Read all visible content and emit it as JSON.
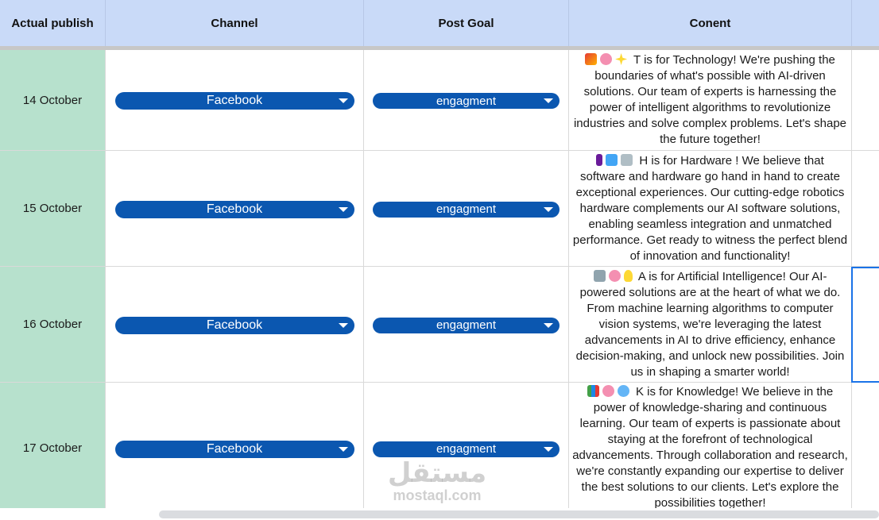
{
  "headers": {
    "actual_publish": "Actual publish",
    "channel": "Channel",
    "post_goal": "Post Goal",
    "content": "Conent"
  },
  "rows": [
    {
      "date": "14 October",
      "channel": "Facebook",
      "goal": "engagment",
      "emojis": [
        "rocket",
        "brain",
        "sparkles"
      ],
      "content": "T is for Technology! We're pushing the boundaries of what's possible with AI-driven solutions. Our team of experts is harnessing the power of intelligent algorithms to revolutionize industries and solve complex problems. Let's shape the future together!"
    },
    {
      "date": "15 October",
      "channel": "Facebook",
      "goal": "engagment",
      "emojis": [
        "plug",
        "computer",
        "microscope"
      ],
      "content": "H is for Hardware ! We believe that software and hardware go hand in hand to create exceptional experiences. Our cutting-edge robotics hardware complements our AI software solutions, enabling seamless integration and unmatched performance. Get ready to witness the perfect blend of innovation and functionality!"
    },
    {
      "date": "16 October",
      "channel": "Facebook",
      "goal": "engagment",
      "emojis": [
        "robot",
        "brain",
        "light-bulb"
      ],
      "content": "A is for Artificial Intelligence! Our AI-powered solutions are at the heart of what we do. From machine learning algorithms to computer vision systems, we're leveraging the latest advancements in AI to drive efficiency, enhance decision-making, and unlock new possibilities. Join us in shaping a smarter world!"
    },
    {
      "date": "17 October",
      "channel": "Facebook",
      "goal": "engagment",
      "emojis": [
        "books",
        "brain",
        "globe"
      ],
      "content": "K is for Knowledge! We believe in the power of knowledge-sharing and continuous learning. Our team of experts is passionate about staying at the forefront of technological advancements. Through collaboration and research, we're constantly expanding our expertise to deliver the best solutions to our clients. Let's explore the possibilities together!"
    }
  ],
  "watermark": {
    "arabic": "مستقل",
    "latin": "mostaql.com"
  },
  "colors": {
    "header_bg": "#c9daf8",
    "date_bg": "#b7e1cd",
    "chip_bg": "#0b57b0",
    "selection": "#1a73e8"
  }
}
